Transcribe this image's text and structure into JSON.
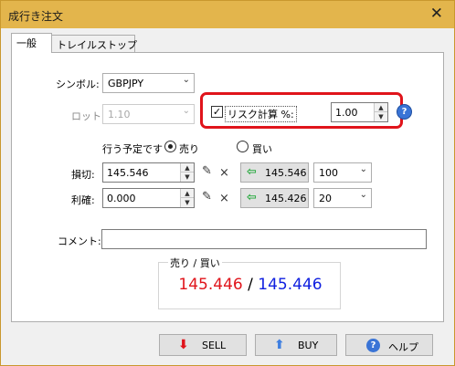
{
  "window": {
    "title": "成行き注文",
    "close_glyph": "✕"
  },
  "tabs": [
    {
      "label": "一般",
      "active": true
    },
    {
      "label": "トレイルストップ",
      "active": false
    }
  ],
  "symbol": {
    "label": "シンボル:",
    "value": "GBPJPY"
  },
  "lot": {
    "label": "ロット:",
    "value": "1.10"
  },
  "risk": {
    "checked": true,
    "label": "リスク計算 %:",
    "value": "1.00",
    "help_icon": "question-icon"
  },
  "side": {
    "label": "行う予定です",
    "options": [
      {
        "label": "売り",
        "selected": true
      },
      {
        "label": "買い",
        "selected": false
      }
    ]
  },
  "stoploss": {
    "label": "損切:",
    "value": "145.546",
    "price_button": "145.546",
    "points": "100"
  },
  "takeprofit": {
    "label": "利確:",
    "value": "0.000",
    "price_button": "145.426",
    "points": "20"
  },
  "comment": {
    "label": "コメント:",
    "value": ""
  },
  "quote": {
    "caption": "売り / 買い",
    "bid": "145.446",
    "separator": " / ",
    "ask": "145.446",
    "bid_color": "#e0141b",
    "ask_color": "#1020e0"
  },
  "buttons": {
    "sell": "SELL",
    "buy": "BUY",
    "help": "ヘルプ"
  }
}
